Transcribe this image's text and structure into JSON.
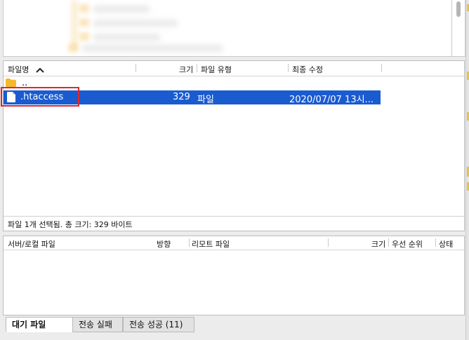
{
  "file_list": {
    "columns": {
      "name": "파일명",
      "size": "크기",
      "type": "파일 유형",
      "modified": "최종 수정"
    },
    "rows": [
      {
        "name": "..",
        "size": "",
        "type": "",
        "modified": "",
        "icon": "folder-icon"
      },
      {
        "name": ".htaccess",
        "size": "329",
        "type": "파일",
        "modified": "2020/07/07 13시...",
        "icon": "document-icon",
        "selected": true
      }
    ],
    "status": "파일 1개 선택됨. 총 크기: 329 바이트"
  },
  "queue": {
    "columns": {
      "server_local_file": "서버/로컬 파일",
      "direction": "방향",
      "remote_file": "리모트 파일",
      "size": "크기",
      "priority": "우선 순위",
      "status": "상태"
    }
  },
  "tabs": [
    {
      "label": "대기 파일",
      "active": true
    },
    {
      "label": "전송 실패",
      "active": false
    },
    {
      "label": "전송 성공 (11)",
      "active": false
    }
  ],
  "colors": {
    "selection": "#1a5bd0",
    "highlight_border": "#e0262b",
    "folder": "#f5b82e"
  }
}
